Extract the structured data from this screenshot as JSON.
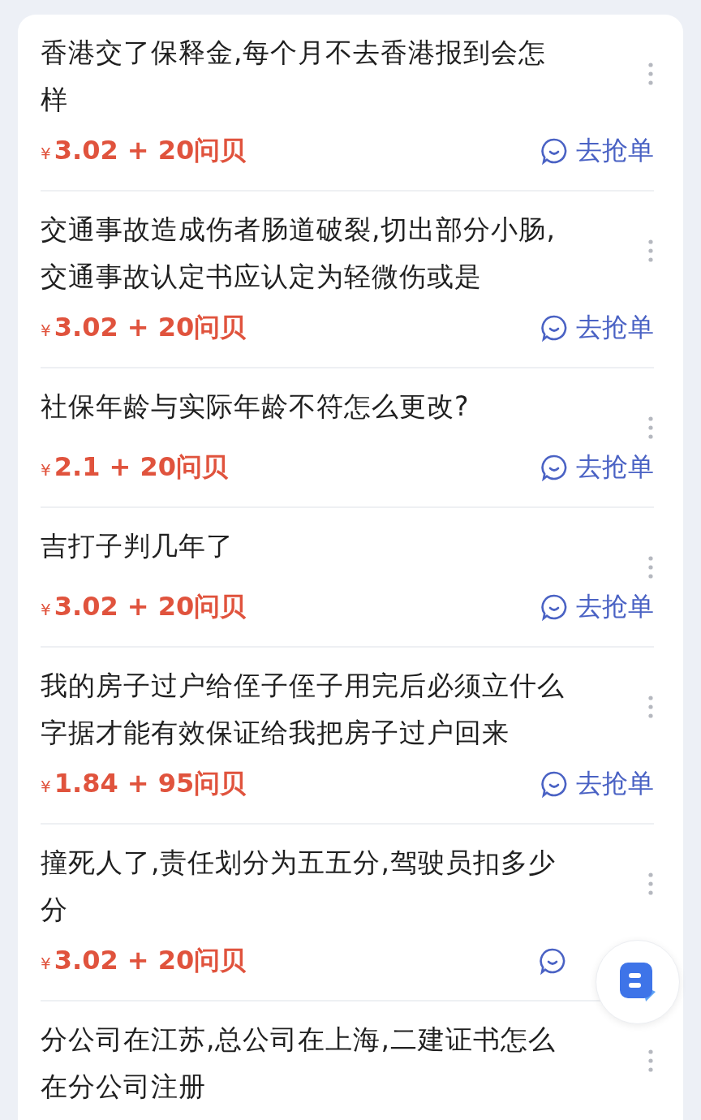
{
  "items": [
    {
      "title": "香港交了保释金,每个月不去香港报到会怎样",
      "currency": "¥",
      "reward": "3.02 + 20问贝",
      "action": "去抢单"
    },
    {
      "title": "交通事故造成伤者肠道破裂,切出部分小肠,交通事故认定书应认定为轻微伤或是",
      "currency": "¥",
      "reward": "3.02 + 20问贝",
      "action": "去抢单"
    },
    {
      "title": "社保年龄与实际年龄不符怎么更改?",
      "currency": "¥",
      "reward": "2.1 + 20问贝",
      "action": "去抢单"
    },
    {
      "title": "吉打子判几年了",
      "currency": "¥",
      "reward": "3.02 + 20问贝",
      "action": "去抢单"
    },
    {
      "title": "我的房子过户给侄子侄子用完后必须立什么字据才能有效保证给我把房子过户回来",
      "currency": "¥",
      "reward": "1.84 + 95问贝",
      "action": "去抢单"
    },
    {
      "title": "撞死人了,责任划分为五五分,驾驶员扣多少分",
      "currency": "¥",
      "reward": "3.02 + 20问贝",
      "grab": true
    },
    {
      "title": "分公司在江苏,总公司在上海,二建证书怎么在分公司注册"
    }
  ]
}
